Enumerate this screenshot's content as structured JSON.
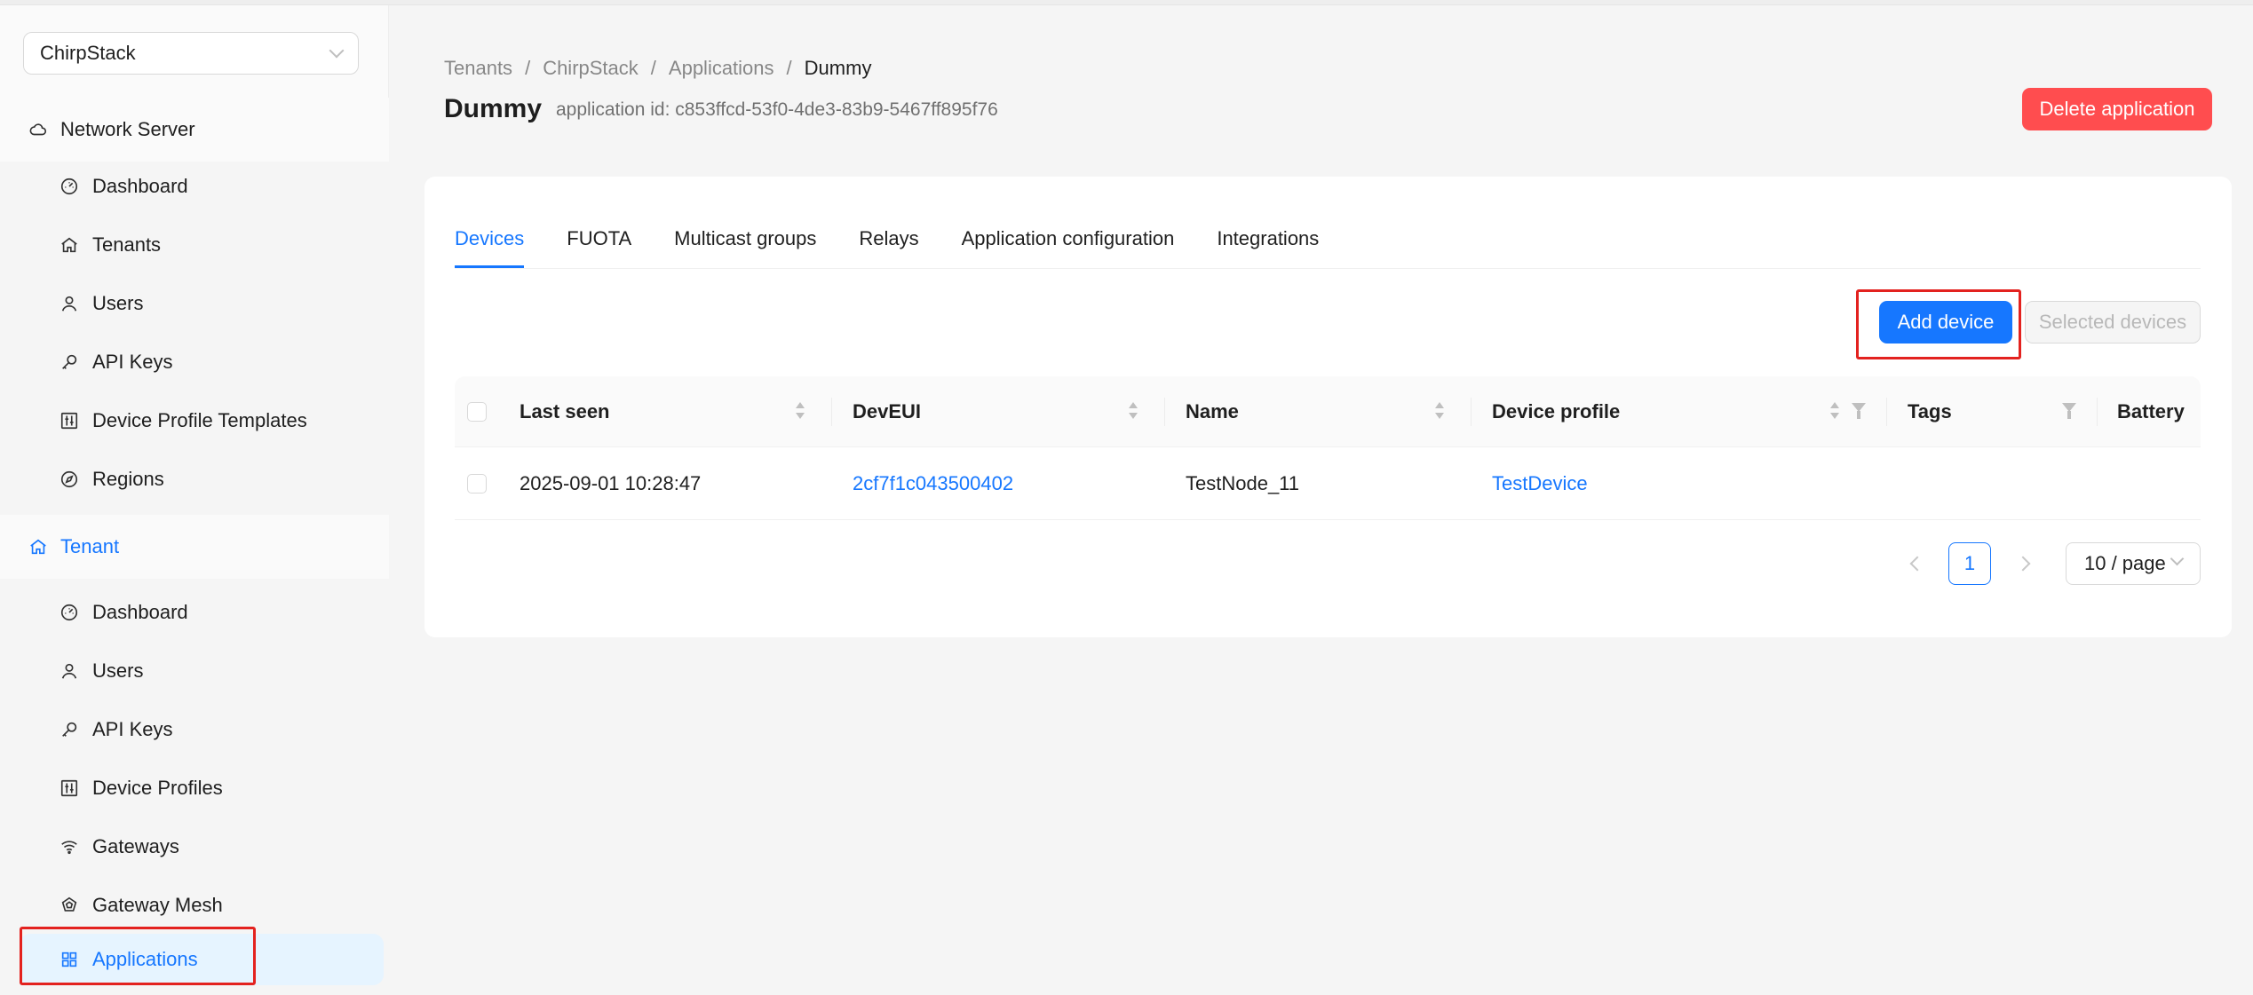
{
  "sidebar": {
    "tenant_select": "ChirpStack",
    "network_server": {
      "label": "Network Server",
      "items": [
        {
          "label": "Dashboard",
          "icon": "dashboard-icon"
        },
        {
          "label": "Tenants",
          "icon": "home-icon"
        },
        {
          "label": "Users",
          "icon": "user-icon"
        },
        {
          "label": "API Keys",
          "icon": "key-icon"
        },
        {
          "label": "Device Profile Templates",
          "icon": "sliders-icon"
        },
        {
          "label": "Regions",
          "icon": "compass-icon"
        }
      ]
    },
    "tenant": {
      "label": "Tenant",
      "items": [
        {
          "label": "Dashboard",
          "icon": "dashboard-icon"
        },
        {
          "label": "Users",
          "icon": "user-icon"
        },
        {
          "label": "API Keys",
          "icon": "key-icon"
        },
        {
          "label": "Device Profiles",
          "icon": "sliders-icon"
        },
        {
          "label": "Gateways",
          "icon": "wifi-icon"
        },
        {
          "label": "Gateway Mesh",
          "icon": "mesh-icon"
        },
        {
          "label": "Applications",
          "icon": "apps-icon",
          "selected": true
        }
      ]
    }
  },
  "breadcrumb": [
    "Tenants",
    "ChirpStack",
    "Applications",
    "Dummy"
  ],
  "header": {
    "title": "Dummy",
    "subtitle": "application id: c853ffcd-53f0-4de3-83b9-5467ff895f76",
    "delete_label": "Delete application"
  },
  "tabs": [
    "Devices",
    "FUOTA",
    "Multicast groups",
    "Relays",
    "Application configuration",
    "Integrations"
  ],
  "actions": {
    "add_device": "Add device",
    "selected_devices": "Selected devices"
  },
  "table": {
    "columns": [
      "Last seen",
      "DevEUI",
      "Name",
      "Device profile",
      "Tags",
      "Battery"
    ],
    "rows": [
      {
        "last_seen": "2025-09-01 10:28:47",
        "dev_eui": "2cf7f1c043500402",
        "name": "TestNode_11",
        "device_profile": "TestDevice",
        "tags": "",
        "battery": ""
      }
    ]
  },
  "pagination": {
    "current_page": "1",
    "page_size": "10 / page"
  },
  "colors": {
    "primary": "#1677ff",
    "danger": "#ff4d4f",
    "highlight": "#e3221f"
  }
}
